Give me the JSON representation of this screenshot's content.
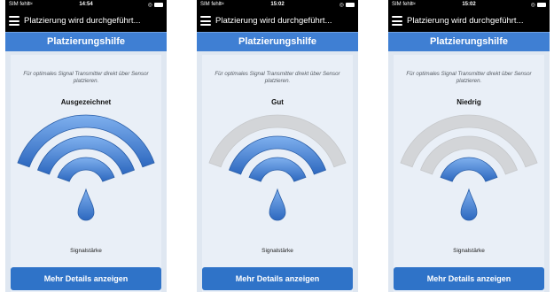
{
  "colors": {
    "active": "#3f7fd3",
    "inactive": "#d3d5d8",
    "header": "#3f7fd3",
    "button": "#2f73c8"
  },
  "screens": [
    {
      "status": {
        "carrier": "SIM fehlt",
        "time": "14:54"
      },
      "title": "Platzierung wird durchgeführt...",
      "header": "Platzierungshilfe",
      "instruction": "Für optimales Signal Transmitter direkt über Sensor platzieren.",
      "quality": "Ausgezeichnet",
      "signal_level": 3,
      "signal_max": 3,
      "signal_label": "Signalstärke",
      "button": "Mehr Details anzeigen"
    },
    {
      "status": {
        "carrier": "SIM fehlt",
        "time": "15:02"
      },
      "title": "Platzierung wird durchgeführt...",
      "header": "Platzierungshilfe",
      "instruction": "Für optimales Signal Transmitter direkt über Sensor platzieren.",
      "quality": "Gut",
      "signal_level": 2,
      "signal_max": 3,
      "signal_label": "Signalstärke",
      "button": "Mehr Details anzeigen"
    },
    {
      "status": {
        "carrier": "SIM fehlt",
        "time": "15:02"
      },
      "title": "Platzierung wird durchgeführt...",
      "header": "Platzierungshilfe",
      "instruction": "Für optimales Signal Transmitter direkt über Sensor platzieren.",
      "quality": "Niedrig",
      "signal_level": 1,
      "signal_max": 3,
      "signal_label": "Signalstärke",
      "button": "Mehr Details anzeigen"
    }
  ]
}
